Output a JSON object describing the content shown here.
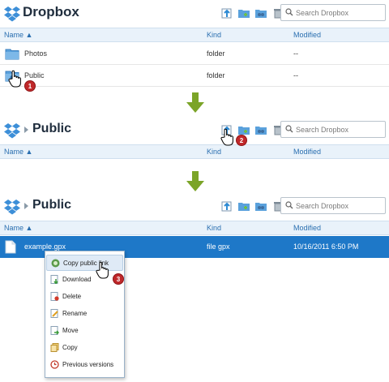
{
  "colors": {
    "header_bg": "#e9f2fa",
    "link_blue": "#2a6fb0",
    "selected_row": "#1e78c8",
    "badge_red": "#c0282a",
    "arrow_green": "#7ba428"
  },
  "icons": [
    "dropbox-logo-icon",
    "upload-icon",
    "new-folder-icon",
    "share-folder-icon",
    "recycle-bin-icon",
    "search-icon",
    "folder-icon",
    "public-folder-icon",
    "file-icon",
    "hand-cursor-icon"
  ],
  "step1": {
    "title": "Dropbox",
    "search_placeholder": "Search Dropbox",
    "columns": {
      "name": "Name ▲",
      "kind": "Kind",
      "modified": "Modified"
    },
    "rows": [
      {
        "name": "Photos",
        "kind": "folder",
        "modified": "--"
      },
      {
        "name": "Public",
        "kind": "folder",
        "modified": "--"
      }
    ],
    "badge": "1"
  },
  "step2": {
    "title": "Public",
    "search_placeholder": "Search Dropbox",
    "columns": {
      "name": "Name ▲",
      "kind": "Kind",
      "modified": "Modified"
    },
    "badge": "2"
  },
  "step3": {
    "title": "Public",
    "search_placeholder": "Search Dropbox",
    "columns": {
      "name": "Name ▲",
      "kind": "Kind",
      "modified": "Modified"
    },
    "file": {
      "name": "example.gpx",
      "kind": "file  gpx",
      "modified": "10/16/2011 6:50 PM"
    },
    "menu": [
      {
        "label": "Copy public link",
        "icon": "link-icon"
      },
      {
        "label": "Download",
        "icon": "download-icon"
      },
      {
        "label": "Delete",
        "icon": "delete-icon"
      },
      {
        "label": "Rename",
        "icon": "rename-icon"
      },
      {
        "label": "Move",
        "icon": "move-icon"
      },
      {
        "label": "Copy",
        "icon": "copy-icon"
      },
      {
        "label": "Previous versions",
        "icon": "history-icon"
      }
    ],
    "badge": "3"
  }
}
